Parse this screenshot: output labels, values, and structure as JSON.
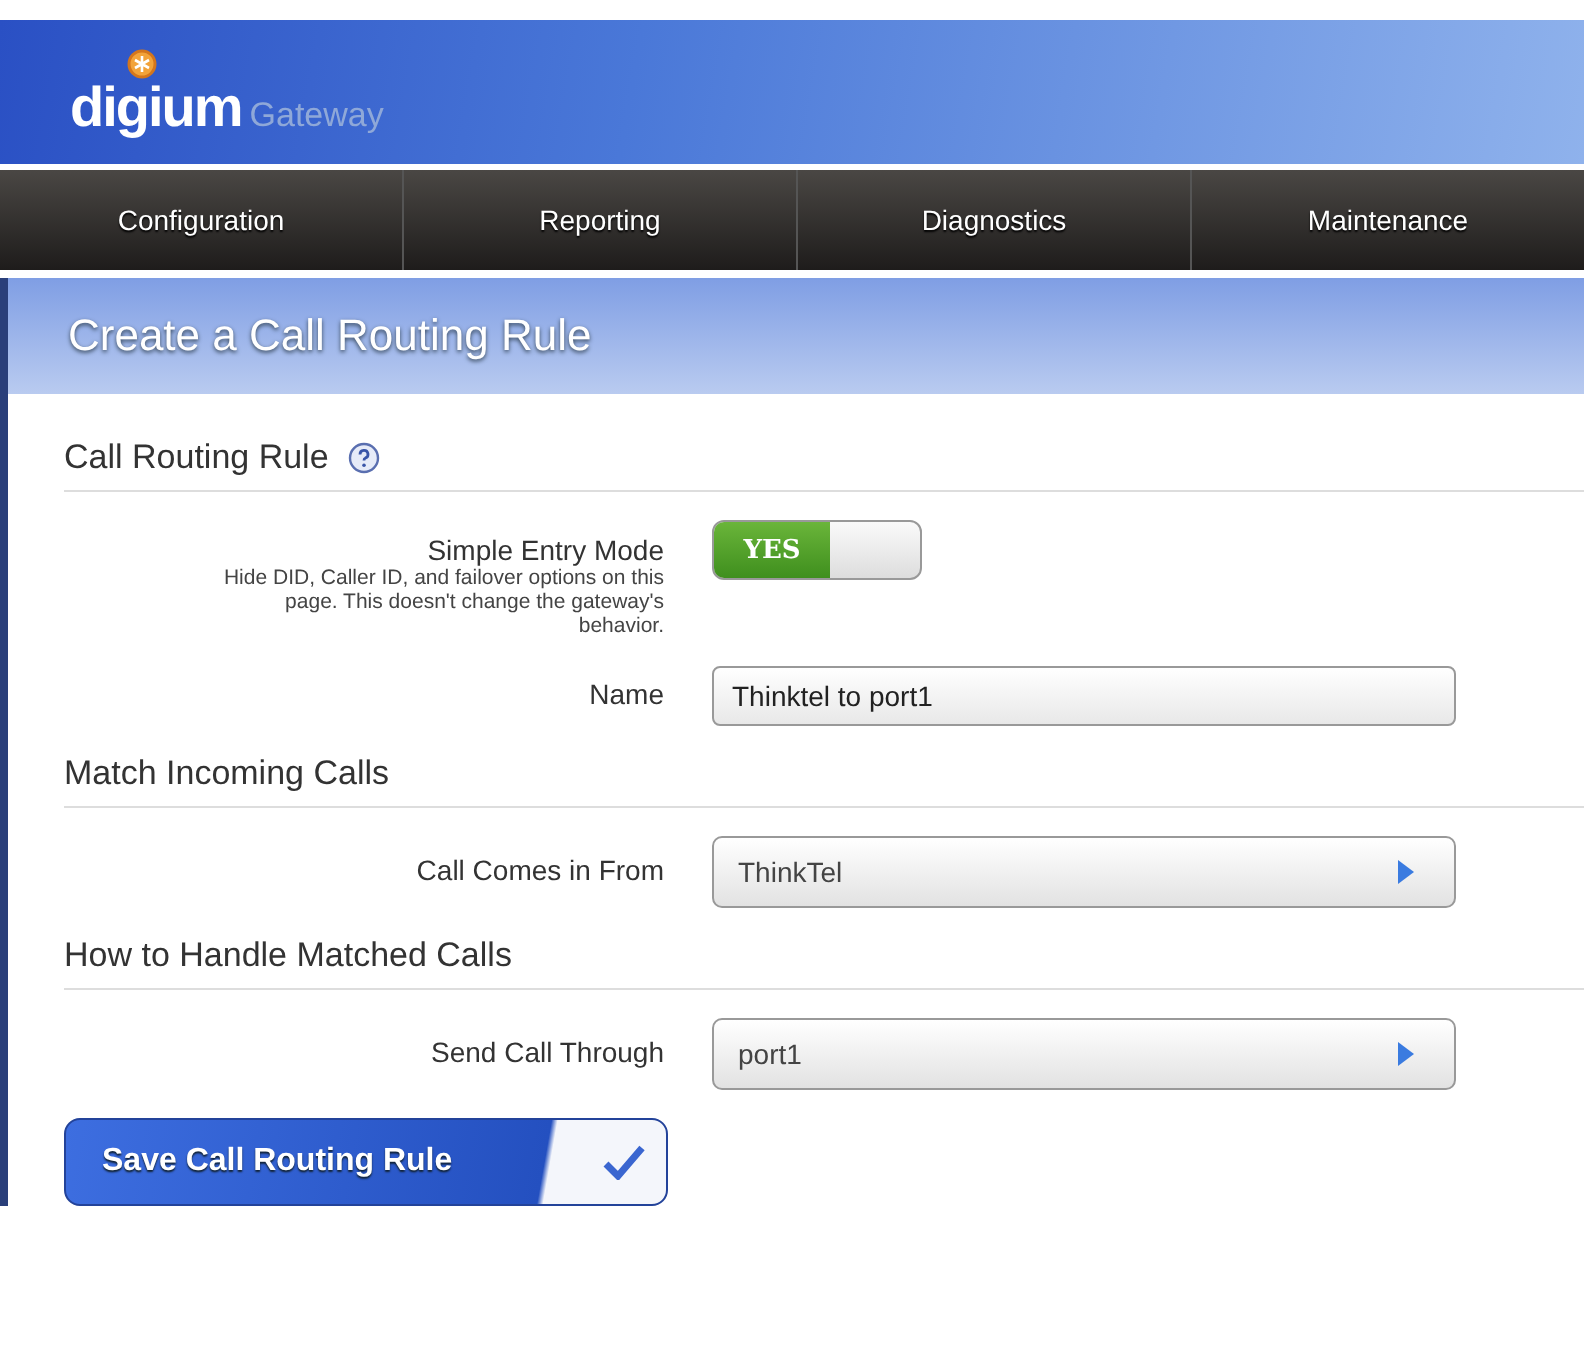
{
  "header": {
    "brand": "digium",
    "product": "Gateway"
  },
  "nav": [
    {
      "label": "Configuration"
    },
    {
      "label": "Reporting"
    },
    {
      "label": "Diagnostics"
    },
    {
      "label": "Maintenance"
    }
  ],
  "page_title": "Create a Call Routing Rule",
  "sections": [
    {
      "title": "Call Routing Rule",
      "help": true,
      "fields": [
        {
          "kind": "toggle",
          "label": "Simple Entry Mode",
          "description": "Hide DID, Caller ID, and failover options on this page. This doesn't change the gateway's behavior.",
          "on": true,
          "on_text": "YES"
        },
        {
          "kind": "text",
          "label": "Name",
          "value": "Thinktel to port1"
        }
      ]
    },
    {
      "title": "Match Incoming Calls",
      "help": false,
      "fields": [
        {
          "kind": "select",
          "label": "Call Comes in From",
          "value": "ThinkTel"
        }
      ]
    },
    {
      "title": "How to Handle Matched Calls",
      "help": false,
      "fields": [
        {
          "kind": "select",
          "label": "Send Call Through",
          "value": "port1"
        }
      ]
    }
  ],
  "save_button": "Save Call Routing Rule"
}
